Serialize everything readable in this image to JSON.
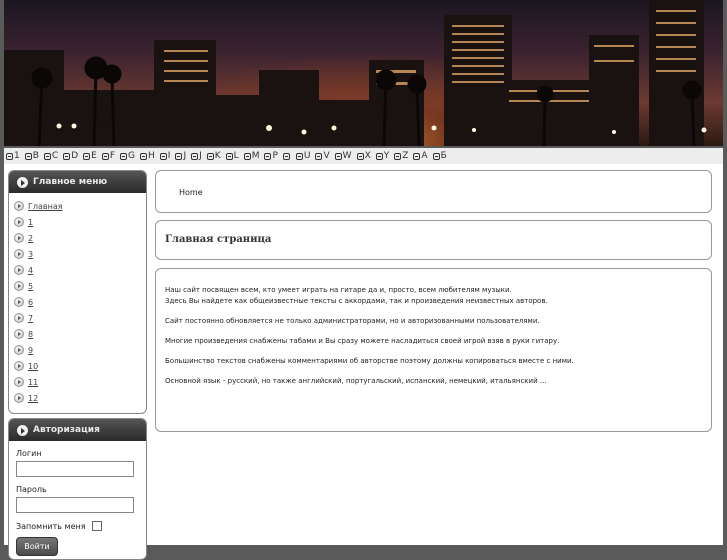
{
  "header": {
    "image": "night-city-skyline-photo"
  },
  "letters": [
    "1",
    "B",
    "C",
    "D",
    "E",
    "F",
    "G",
    "H",
    "I",
    "J",
    "J",
    "K",
    "L",
    "M",
    "P",
    "",
    "U",
    "V",
    "W",
    "X",
    "Y",
    "Z",
    "A",
    "Б"
  ],
  "sidebar": {
    "menu": {
      "title": "Главное меню",
      "items": [
        "Главная",
        "1",
        "2",
        "3",
        "4",
        "5",
        "6",
        "7",
        "8",
        "9",
        "10",
        "11",
        "12"
      ]
    },
    "auth": {
      "title": "Авторизация",
      "login_label": "Логин",
      "password_label": "Пароль",
      "remember_label": "Запомнить меня",
      "submit_label": "Войти"
    }
  },
  "breadcrumb": {
    "home": "Home"
  },
  "page_title": "Главная страница",
  "content": {
    "p1_line1": "Наш сайт посвящен всем, кто умеет играть на гитаре да и, просто, всем любителям музыки.",
    "p1_line2": "Здесь Вы найдете как общеизвестные тексты с аккордами, так и произведения неизвестных авторов.",
    "p2": "Сайт постоянно обновляется не только администраторами, но и авторизованными пользователями.",
    "p3": "Многие произведения снабжены табами и Вы сразу можете насладиться своей игрой взяв в руки гитару.",
    "p4": "Большинство текстов снабжены комментариями об авторстве поэтому должны копироваться вместе с ними.",
    "p5": "Основной язык - русский, но также английский, португальский, испанский, немецкий, итальянский ..."
  },
  "colors": {
    "page_bg": "#5a5a5a",
    "box_header": "#2a2a2a",
    "accent": "#d77a3a"
  }
}
